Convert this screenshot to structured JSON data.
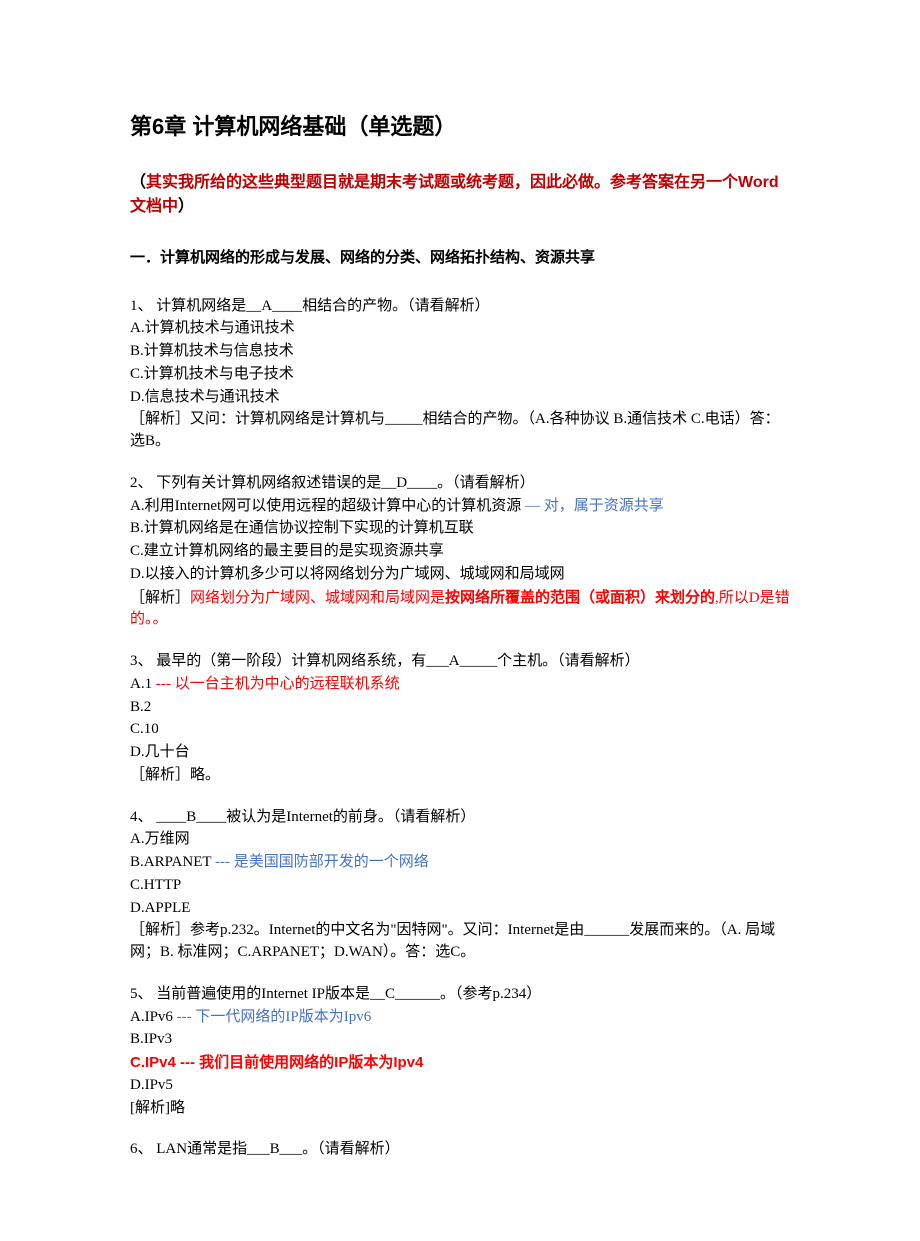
{
  "title": "第6章 计算机网络基础（单选题）",
  "note": {
    "p1_black": "（",
    "p1_red": "其实我所给的这些典型题目就是期末考试题或统考题，因此必做。参考答案在另一个Word文档中",
    "p1_black_end": "）"
  },
  "section_head": "一．计算机网络的形成与发展、网络的分类、网络拓扑结构、资源共享",
  "q1": {
    "line": "1、 计算机网络是__A____相结合的产物。（请看解析）",
    "a": "A.计算机技术与通讯技术",
    "b": "B.计算机技术与信息技术",
    "c": "C.计算机技术与电子技术",
    "d": "D.信息技术与通讯技术",
    "analysis": "［解析］又问：计算机网络是计算机与_____相结合的产物。（A.各种协议 B.通信技术 C.电话）答：选B。"
  },
  "q2": {
    "line": "2、 下列有关计算机网络叙述错误的是__D____。（请看解析）",
    "a1": "A.利用Internet网可以使用远程的超级计算中心的计算机资源",
    "a1_note": "  — 对，属于资源共享",
    "b": "B.计算机网络是在通信协议控制下实现的计算机互联",
    "c": "C.建立计算机网络的最主要目的是实现资源共享",
    "d": "D.以接入的计算机多少可以将网络划分为广域网、城域网和局域网",
    "analysis_prefix": "［解析］",
    "analysis_red1": "网络划分为广域网、城域网和局域网是",
    "analysis_red_bold": "按网络所覆盖的范围（或面积）来划分的",
    "analysis_red2": ",所以D是错的。。"
  },
  "q3": {
    "line": "3、 最早的（第一阶段）计算机网络系统，有___A_____个主机。（请看解析）",
    "a1": "A.1",
    "a1_note": "   --- 以一台主机为中心的远程联机系统",
    "b": "B.2",
    "c": "C.10",
    "d": "D.几十台",
    "analysis": "［解析］略。"
  },
  "q4": {
    "line": "4、 ____B____被认为是Internet的前身。（请看解析）",
    "a": "A.万维网",
    "b1": "B.ARPANET",
    "b1_note": "    --- 是美国国防部开发的一个网络",
    "c": "C.HTTP",
    "d": "D.APPLE",
    "analysis": "［解析］参考p.232。Internet的中文名为\"因特网\"。又问：Internet是由______发展而来的。（A. 局域网；B. 标准网；C.ARPANET；D.WAN）。答：选C。"
  },
  "q5": {
    "line": "5、 当前普遍使用的Internet IP版本是__C______。（参考p.234）",
    "a1": "A.IPv6",
    "a1_note": "  --- 下一代网络的IP版本为Ipv6",
    "b": "B.IPv3",
    "c1": "C.IPv4",
    "c1_note": "   --- 我们目前使用网络的IP版本为Ipv4",
    "d": "D.IPv5",
    "analysis": "[解析]略"
  },
  "q6": {
    "line": "6、 LAN通常是指___B___。（请看解析）"
  }
}
